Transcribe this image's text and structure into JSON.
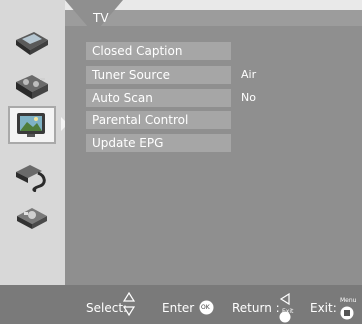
{
  "header": {
    "tab_label": "TV"
  },
  "sidebar": {
    "items": [
      {
        "icon": "picture-icon"
      },
      {
        "icon": "audio-icon"
      },
      {
        "icon": "tv-icon",
        "selected": true
      },
      {
        "icon": "setup-icon"
      },
      {
        "icon": "lock-icon"
      }
    ]
  },
  "menu": {
    "items": [
      {
        "label": "Closed Caption",
        "value": ""
      },
      {
        "label": "Tuner Source",
        "value": "Air"
      },
      {
        "label": "Auto Scan",
        "value": "No"
      },
      {
        "label": "Parental Control",
        "value": ""
      },
      {
        "label": "Update EPG",
        "value": ""
      }
    ]
  },
  "footer": {
    "select_label": "Select:",
    "enter_label": "Enter",
    "enter_key": "OK",
    "return_label": "Return :",
    "return_key": "Exit",
    "exit_label": "Exit:",
    "exit_key": "Menu"
  },
  "colors": {
    "panel": "#8f8f8f",
    "row": "#a6a6a6",
    "footer": "#7a7a7a",
    "text": "#ffffff"
  }
}
